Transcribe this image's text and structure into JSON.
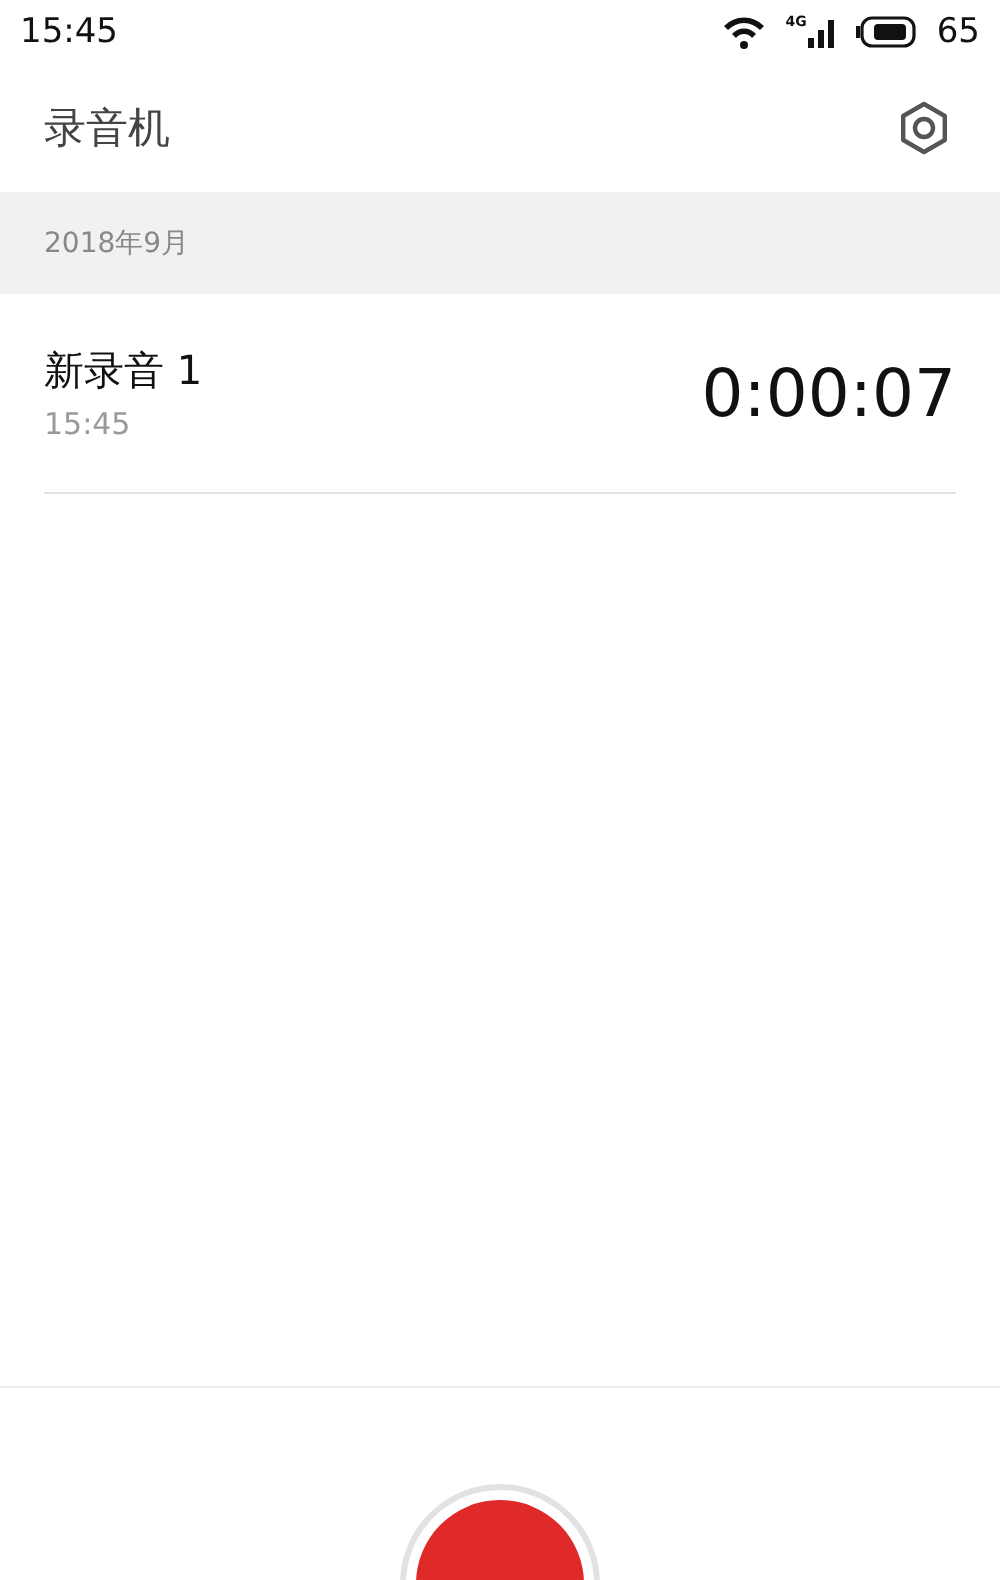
{
  "status_bar": {
    "time": "15:45",
    "network": "4G",
    "battery": "65"
  },
  "header": {
    "title": "录音机"
  },
  "sections": [
    {
      "title": "2018年9月",
      "recordings": [
        {
          "name": "新录音 1",
          "time": "15:45",
          "duration": "0:00:07"
        }
      ]
    }
  ]
}
